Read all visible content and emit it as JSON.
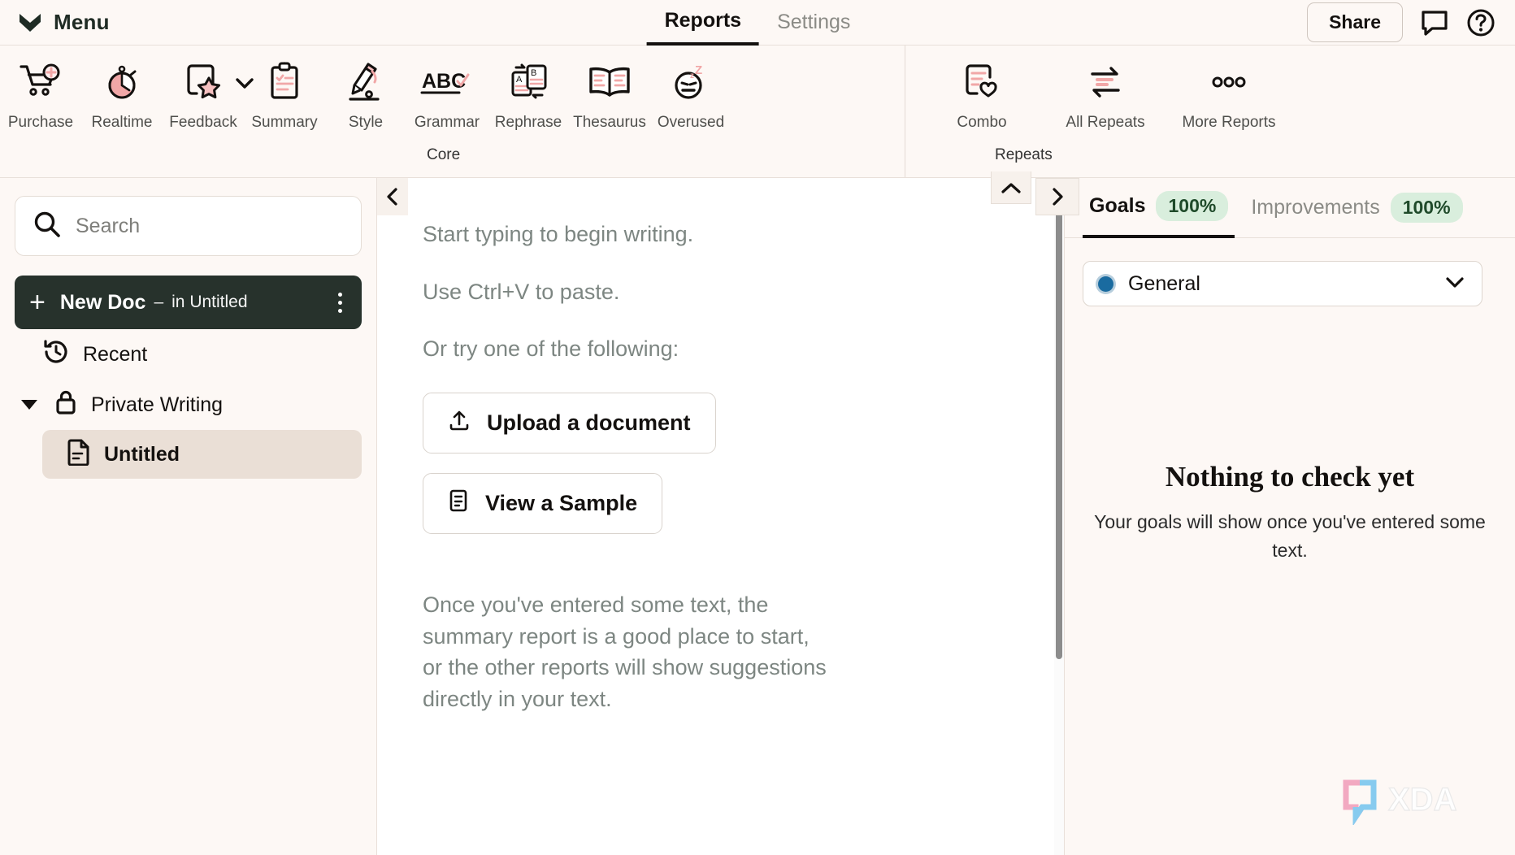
{
  "app": {
    "menu_label": "Menu",
    "logo_icon": "prowritingaid-chevron-logo"
  },
  "header": {
    "tabs": [
      {
        "label": "Reports",
        "active": true
      },
      {
        "label": "Settings",
        "active": false
      }
    ],
    "share_label": "Share",
    "comment_icon": "comment-bubble-icon",
    "help_icon": "help-circle-icon"
  },
  "ribbon": {
    "groups": [
      {
        "title": "Core",
        "items": [
          {
            "label": "Purchase",
            "icon": "cart-plus-icon"
          },
          {
            "label": "Realtime",
            "icon": "stopwatch-icon"
          },
          {
            "label": "Feedback",
            "icon": "doc-star-icon",
            "has_dropdown": true
          },
          {
            "label": "Summary",
            "icon": "clipboard-check-icon"
          },
          {
            "label": "Style",
            "icon": "pencil-icon"
          },
          {
            "label": "Grammar",
            "icon": "abc-check-icon"
          },
          {
            "label": "Rephrase",
            "icon": "swap-cards-icon"
          },
          {
            "label": "Thesaurus",
            "icon": "open-book-icon"
          },
          {
            "label": "Overused",
            "icon": "sleepy-face-icon"
          }
        ]
      },
      {
        "title": "Repeats",
        "items": [
          {
            "label": "Combo",
            "icon": "doc-heart-icon"
          },
          {
            "label": "All Repeats",
            "icon": "repeat-arrows-icon"
          },
          {
            "label": "More Reports",
            "icon": "ellipsis-icon"
          }
        ]
      }
    ]
  },
  "sidebar": {
    "search": {
      "placeholder": "Search",
      "icon": "search-icon"
    },
    "new_doc": {
      "plus": "+",
      "title": "New Doc",
      "dash": "–",
      "subtitle": "in Untitled",
      "menu_icon": "kebab-menu-icon"
    },
    "nav": [
      {
        "label": "Recent",
        "icon": "history-clock-icon"
      },
      {
        "label": "Private Writing",
        "icon": "lock-icon",
        "expanded": true
      }
    ],
    "documents": [
      {
        "label": "Untitled",
        "icon": "document-icon",
        "selected": true
      }
    ]
  },
  "editor": {
    "lines": [
      "Start typing to begin writing.",
      "Use Ctrl+V to paste.",
      "Or try one of the following:"
    ],
    "buttons": [
      {
        "label": "Upload a document",
        "icon": "upload-icon"
      },
      {
        "label": "View a Sample",
        "icon": "document-lines-icon"
      }
    ],
    "note": "Once you've entered some text, the summary report is a good place to start, or the other reports will show suggestions directly in your text.",
    "collapse_left_icon": "chevron-left-icon",
    "collapse_up_icon": "chevron-up-icon"
  },
  "right_panel": {
    "collapse_icon": "chevron-right-icon",
    "tabs": [
      {
        "label": "Goals",
        "badge": "100%",
        "active": true
      },
      {
        "label": "Improvements",
        "badge": "100%",
        "active": false
      }
    ],
    "selector": {
      "label": "General",
      "dot_color": "#1a6ba0",
      "chevron_icon": "chevron-down-icon"
    },
    "empty_state": {
      "title": "Nothing to check yet",
      "subtitle": "Your goals will show once you've entered some text."
    }
  },
  "watermark": {
    "text": "XDA"
  },
  "colors": {
    "background": "#fdf8f5",
    "accent_pink": "#f1a7a7",
    "dark": "#27322c",
    "selected_doc": "#eadfd6",
    "badge_green_bg": "#d9eedd",
    "badge_green_text": "#1f4a2a",
    "dot_blue": "#1a6ba0"
  }
}
